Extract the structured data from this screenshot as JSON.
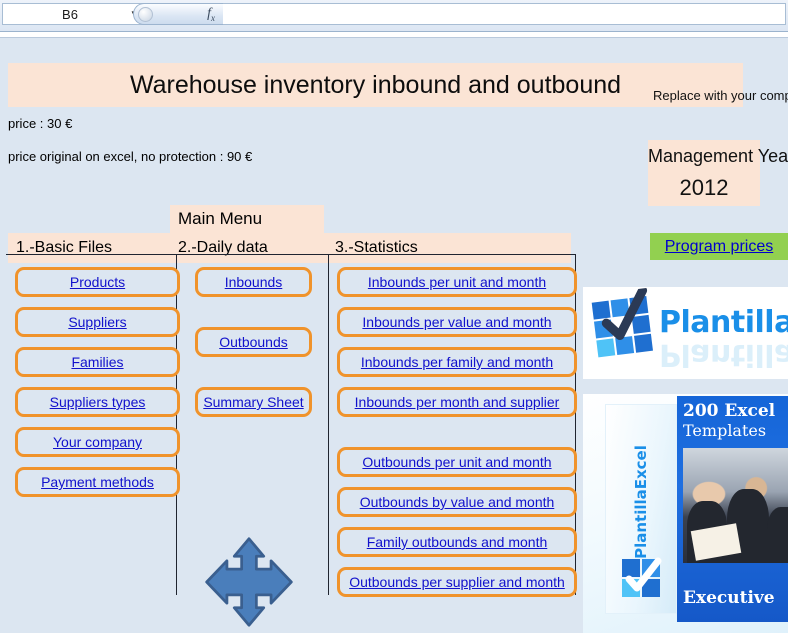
{
  "formula_bar": {
    "name_box_value": "B6",
    "caret_icon": "chevron-down-icon",
    "fx_icon": "fx-insert-function-icon",
    "formula_value": "",
    "formula_placeholder": ""
  },
  "sheet": {
    "title": "Warehouse inventory inbound and outbound",
    "price_line": "price : 30 €",
    "price_original_line": "price original on excel, no protection : 90 €",
    "replace_note": "Replace with your company logo",
    "management_label": "Management Year",
    "management_year": "2012",
    "main_menu_label": "Main Menu",
    "menu_items": [
      {
        "label": "1.-Basic Files"
      },
      {
        "label": "2.-Daily data"
      },
      {
        "label": "3.-Statistics"
      }
    ],
    "program_prices_label": "Program prices"
  },
  "panels": {
    "basic_files": [
      {
        "label": "Products"
      },
      {
        "label": "Suppliers"
      },
      {
        "label": "Families"
      },
      {
        "label": "Suppliers types"
      },
      {
        "label": "Your company"
      },
      {
        "label": "Payment methods"
      }
    ],
    "daily_data": [
      {
        "label": "Inbounds"
      },
      {
        "label": "Outbounds"
      },
      {
        "label": "Summary Sheet"
      }
    ],
    "statistics": [
      {
        "label": "Inbounds per unit and month"
      },
      {
        "label": "Inbounds per value and month"
      },
      {
        "label": "Inbounds per family and month"
      },
      {
        "label": "Inbounds per month and supplier"
      },
      {
        "label": "Outbounds per unit and month"
      },
      {
        "label": "Outbounds by value and month"
      },
      {
        "label": "Family outbounds and month"
      },
      {
        "label": "Outbounds per supplier and month"
      }
    ],
    "move_arrow_icon": "four-way-arrow-icon"
  },
  "graphics": {
    "logo_text": "PlantillaExcel",
    "logo_icon": "checkmark-grid-icon",
    "box_spine_text": "PlantillaExcel",
    "box_title_line1": "200 Excel",
    "box_title_line2": "Templates",
    "box_footer": "Executive",
    "box_icon": "checkmark-grid-icon"
  },
  "colors": {
    "sheet_background": "#dce6f1",
    "highlight_peach": "#fbe4d5",
    "button_border_orange": "#f0932b",
    "link_blue": "#1111cc",
    "program_prices_green": "#92d050",
    "brand_blue": "#1a8fe8",
    "arrow_blue": "#4a7ebb"
  }
}
